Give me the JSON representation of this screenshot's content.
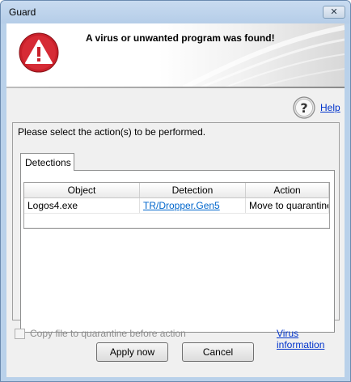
{
  "window": {
    "title": "Guard",
    "close_glyph": "✕"
  },
  "banner": {
    "message": "A virus or unwanted program was found!",
    "icon": "warning-icon"
  },
  "help": {
    "label": "Help",
    "icon": "help-icon"
  },
  "panel": {
    "instruction": "Please select the action(s) to be performed.",
    "tab_label": "Detections"
  },
  "table": {
    "columns": [
      "Object",
      "Detection",
      "Action"
    ],
    "rows": [
      {
        "object": "Logos4.exe",
        "detection": "TR/Dropper.Gen5",
        "action": "Move to quarantine"
      }
    ]
  },
  "footer": {
    "checkbox_label": "Copy file to quarantine before action",
    "checkbox_checked": false,
    "virus_info_label": "Virus information",
    "apply_label": "Apply now",
    "cancel_label": "Cancel"
  },
  "colors": {
    "link": "#0033cc",
    "warning_red": "#c8202a",
    "frame": "#b9d1ea"
  }
}
